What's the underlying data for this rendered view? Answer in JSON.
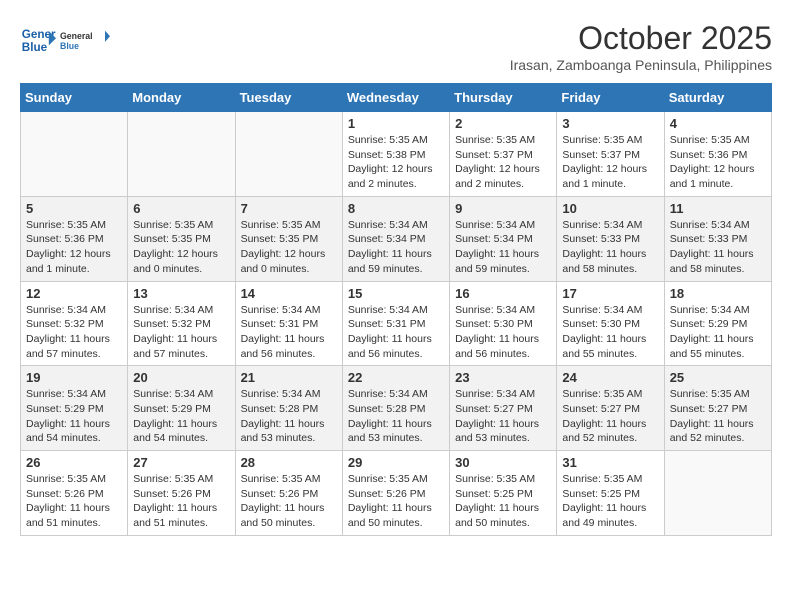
{
  "header": {
    "logo_line1": "General",
    "logo_line2": "Blue",
    "month": "October 2025",
    "location": "Irasan, Zamboanga Peninsula, Philippines"
  },
  "weekdays": [
    "Sunday",
    "Monday",
    "Tuesday",
    "Wednesday",
    "Thursday",
    "Friday",
    "Saturday"
  ],
  "weeks": [
    [
      {
        "day": "",
        "detail": ""
      },
      {
        "day": "",
        "detail": ""
      },
      {
        "day": "",
        "detail": ""
      },
      {
        "day": "1",
        "detail": "Sunrise: 5:35 AM\nSunset: 5:38 PM\nDaylight: 12 hours\nand 2 minutes."
      },
      {
        "day": "2",
        "detail": "Sunrise: 5:35 AM\nSunset: 5:37 PM\nDaylight: 12 hours\nand 2 minutes."
      },
      {
        "day": "3",
        "detail": "Sunrise: 5:35 AM\nSunset: 5:37 PM\nDaylight: 12 hours\nand 1 minute."
      },
      {
        "day": "4",
        "detail": "Sunrise: 5:35 AM\nSunset: 5:36 PM\nDaylight: 12 hours\nand 1 minute."
      }
    ],
    [
      {
        "day": "5",
        "detail": "Sunrise: 5:35 AM\nSunset: 5:36 PM\nDaylight: 12 hours\nand 1 minute."
      },
      {
        "day": "6",
        "detail": "Sunrise: 5:35 AM\nSunset: 5:35 PM\nDaylight: 12 hours\nand 0 minutes."
      },
      {
        "day": "7",
        "detail": "Sunrise: 5:35 AM\nSunset: 5:35 PM\nDaylight: 12 hours\nand 0 minutes."
      },
      {
        "day": "8",
        "detail": "Sunrise: 5:34 AM\nSunset: 5:34 PM\nDaylight: 11 hours\nand 59 minutes."
      },
      {
        "day": "9",
        "detail": "Sunrise: 5:34 AM\nSunset: 5:34 PM\nDaylight: 11 hours\nand 59 minutes."
      },
      {
        "day": "10",
        "detail": "Sunrise: 5:34 AM\nSunset: 5:33 PM\nDaylight: 11 hours\nand 58 minutes."
      },
      {
        "day": "11",
        "detail": "Sunrise: 5:34 AM\nSunset: 5:33 PM\nDaylight: 11 hours\nand 58 minutes."
      }
    ],
    [
      {
        "day": "12",
        "detail": "Sunrise: 5:34 AM\nSunset: 5:32 PM\nDaylight: 11 hours\nand 57 minutes."
      },
      {
        "day": "13",
        "detail": "Sunrise: 5:34 AM\nSunset: 5:32 PM\nDaylight: 11 hours\nand 57 minutes."
      },
      {
        "day": "14",
        "detail": "Sunrise: 5:34 AM\nSunset: 5:31 PM\nDaylight: 11 hours\nand 56 minutes."
      },
      {
        "day": "15",
        "detail": "Sunrise: 5:34 AM\nSunset: 5:31 PM\nDaylight: 11 hours\nand 56 minutes."
      },
      {
        "day": "16",
        "detail": "Sunrise: 5:34 AM\nSunset: 5:30 PM\nDaylight: 11 hours\nand 56 minutes."
      },
      {
        "day": "17",
        "detail": "Sunrise: 5:34 AM\nSunset: 5:30 PM\nDaylight: 11 hours\nand 55 minutes."
      },
      {
        "day": "18",
        "detail": "Sunrise: 5:34 AM\nSunset: 5:29 PM\nDaylight: 11 hours\nand 55 minutes."
      }
    ],
    [
      {
        "day": "19",
        "detail": "Sunrise: 5:34 AM\nSunset: 5:29 PM\nDaylight: 11 hours\nand 54 minutes."
      },
      {
        "day": "20",
        "detail": "Sunrise: 5:34 AM\nSunset: 5:29 PM\nDaylight: 11 hours\nand 54 minutes."
      },
      {
        "day": "21",
        "detail": "Sunrise: 5:34 AM\nSunset: 5:28 PM\nDaylight: 11 hours\nand 53 minutes."
      },
      {
        "day": "22",
        "detail": "Sunrise: 5:34 AM\nSunset: 5:28 PM\nDaylight: 11 hours\nand 53 minutes."
      },
      {
        "day": "23",
        "detail": "Sunrise: 5:34 AM\nSunset: 5:27 PM\nDaylight: 11 hours\nand 53 minutes."
      },
      {
        "day": "24",
        "detail": "Sunrise: 5:35 AM\nSunset: 5:27 PM\nDaylight: 11 hours\nand 52 minutes."
      },
      {
        "day": "25",
        "detail": "Sunrise: 5:35 AM\nSunset: 5:27 PM\nDaylight: 11 hours\nand 52 minutes."
      }
    ],
    [
      {
        "day": "26",
        "detail": "Sunrise: 5:35 AM\nSunset: 5:26 PM\nDaylight: 11 hours\nand 51 minutes."
      },
      {
        "day": "27",
        "detail": "Sunrise: 5:35 AM\nSunset: 5:26 PM\nDaylight: 11 hours\nand 51 minutes."
      },
      {
        "day": "28",
        "detail": "Sunrise: 5:35 AM\nSunset: 5:26 PM\nDaylight: 11 hours\nand 50 minutes."
      },
      {
        "day": "29",
        "detail": "Sunrise: 5:35 AM\nSunset: 5:26 PM\nDaylight: 11 hours\nand 50 minutes."
      },
      {
        "day": "30",
        "detail": "Sunrise: 5:35 AM\nSunset: 5:25 PM\nDaylight: 11 hours\nand 50 minutes."
      },
      {
        "day": "31",
        "detail": "Sunrise: 5:35 AM\nSunset: 5:25 PM\nDaylight: 11 hours\nand 49 minutes."
      },
      {
        "day": "",
        "detail": ""
      }
    ]
  ]
}
